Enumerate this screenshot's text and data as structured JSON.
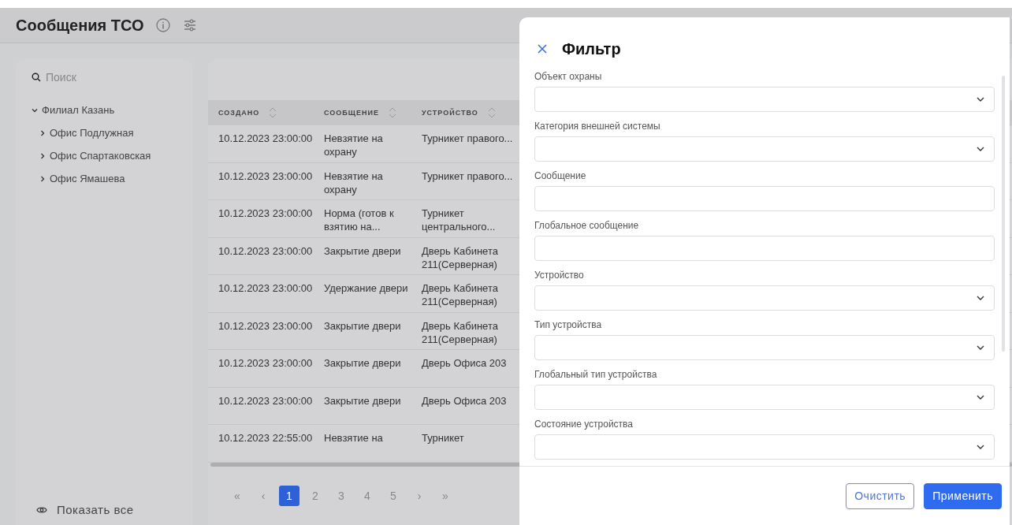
{
  "page": {
    "title": "Сообщения ТСО"
  },
  "sidebar": {
    "search": {
      "placeholder": "Поиск"
    },
    "tree": [
      {
        "label": "Филиал Казань",
        "expanded": true,
        "children": [
          {
            "label": "Офис Подлужная",
            "expanded": false
          },
          {
            "label": "Офис Спартаковская",
            "expanded": false
          },
          {
            "label": "Офис Ямашева",
            "expanded": false
          }
        ]
      }
    ],
    "show_all": "Показать все"
  },
  "table": {
    "columns": [
      "СОЗДАНО",
      "СООБЩЕНИЕ",
      "УСТРОЙСТВО"
    ],
    "rows": [
      [
        "10.12.2023 23:00:00",
        "Невзятие на охрану",
        "Турникет правого..."
      ],
      [
        "10.12.2023 23:00:00",
        "Невзятие на охрану",
        "Турникет правого..."
      ],
      [
        "10.12.2023 23:00:00",
        "Норма (готов к взятию на...",
        "Турникет центрального..."
      ],
      [
        "10.12.2023 23:00:00",
        "Закрытие двери",
        "Дверь Кабинета 211(Серверная)"
      ],
      [
        "10.12.2023 23:00:00",
        "Удержание двери",
        "Дверь Кабинета 211(Серверная)"
      ],
      [
        "10.12.2023 23:00:00",
        "Закрытие двери",
        "Дверь Кабинета 211(Серверная)"
      ],
      [
        "10.12.2023 23:00:00",
        "Закрытие двери",
        "Дверь Офиса 203"
      ],
      [
        "10.12.2023 23:00:00",
        "Закрытие двери",
        "Дверь Офиса 203"
      ],
      [
        "10.12.2023 22:55:00",
        "Невзятие на",
        "Турникет"
      ]
    ]
  },
  "pagination": {
    "first": "«",
    "prev": "‹",
    "next": "›",
    "last": "»",
    "pages": [
      {
        "label": "1",
        "selected": true
      },
      {
        "label": "2",
        "selected": false
      },
      {
        "label": "3",
        "selected": false
      },
      {
        "label": "4",
        "selected": false
      },
      {
        "label": "5",
        "selected": false
      }
    ]
  },
  "filter": {
    "title": "Фильтр",
    "fields": [
      {
        "label": "Объект охраны",
        "kind": "select"
      },
      {
        "label": "Категория внешней системы",
        "kind": "select"
      },
      {
        "label": "Сообщение",
        "kind": "text"
      },
      {
        "label": "Глобальное сообщение",
        "kind": "text"
      },
      {
        "label": "Устройство",
        "kind": "select"
      },
      {
        "label": "Тип устройства",
        "kind": "select"
      },
      {
        "label": "Глобальный тип устройства",
        "kind": "select"
      },
      {
        "label": "Состояние устройства",
        "kind": "select"
      }
    ],
    "buttons": [
      {
        "label": "Очистить",
        "kind": "secondary"
      },
      {
        "label": "Применить",
        "kind": "primary"
      }
    ]
  }
}
